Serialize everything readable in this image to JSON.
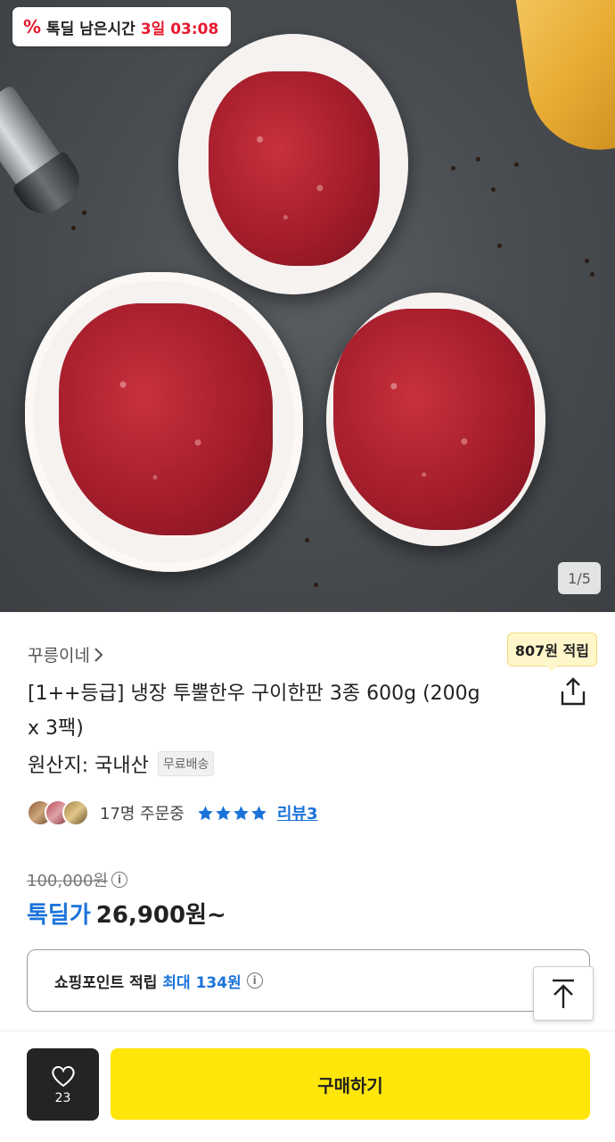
{
  "hero": {
    "deal_badge": {
      "icon": "percent-icon",
      "label": "톡딜 남은시간",
      "time": "3일 03:08"
    },
    "page_counter": "1/5"
  },
  "product": {
    "seller": "꾸릉이네",
    "seller_chevron": "chevron-right-icon",
    "reward_tooltip": "807원 적립",
    "title": "[1++등급] 냉장 투뿔한우 구이한판 3종 600g (200g x 3팩)",
    "origin": "원산지: 국내산",
    "free_shipping": "무료배송",
    "order_count": "17명 주문중",
    "rating_stars": 4,
    "review_link": "리뷰3"
  },
  "price": {
    "original": "100,000원",
    "deal_label": "톡딜가",
    "deal_value": "26,900원~"
  },
  "points": {
    "label": "쇼핑포인트 적립",
    "max": "최대 134원"
  },
  "bottom_bar": {
    "like_count": "23",
    "buy_label": "구매하기"
  },
  "colors": {
    "deal_red": "#e8192f",
    "accent_blue": "#1a73d9",
    "buy_yellow": "#ffe60a",
    "like_dark": "#242424",
    "tooltip_bg": "#fff7c9"
  }
}
